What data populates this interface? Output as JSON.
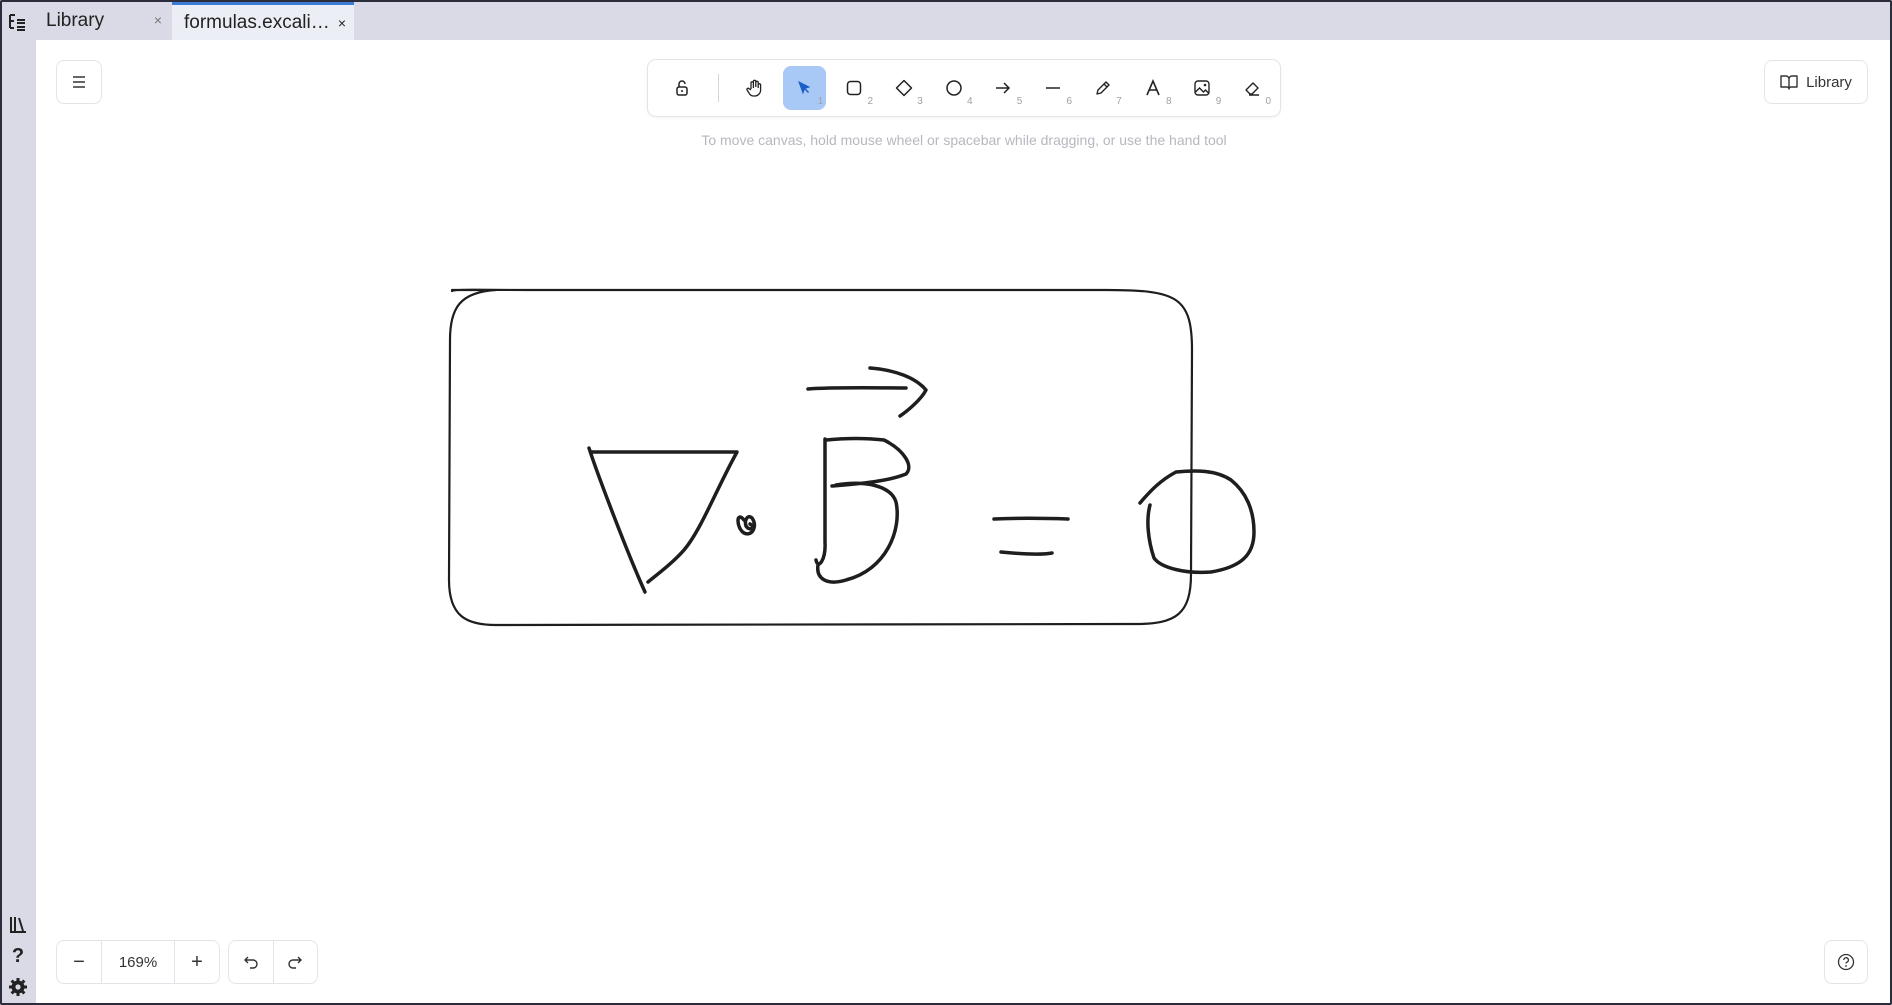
{
  "tabs": [
    {
      "label": "Library",
      "close": "×"
    },
    {
      "label": "formulas.excali…",
      "close": "×"
    }
  ],
  "toolbar": {
    "tools": [
      {
        "name": "hand",
        "key": ""
      },
      {
        "name": "selection",
        "key": "1"
      },
      {
        "name": "rectangle",
        "key": "2"
      },
      {
        "name": "diamond",
        "key": "3"
      },
      {
        "name": "ellipse",
        "key": "4"
      },
      {
        "name": "arrow",
        "key": "5"
      },
      {
        "name": "line",
        "key": "6"
      },
      {
        "name": "draw",
        "key": "7"
      },
      {
        "name": "text",
        "key": "8"
      },
      {
        "name": "image",
        "key": "9"
      },
      {
        "name": "eraser",
        "key": "0"
      }
    ],
    "active_tool": "selection"
  },
  "hint": "To move canvas, hold mouse wheel or spacebar while dragging, or use the hand tool",
  "library_button": {
    "label": "Library"
  },
  "zoom": {
    "minus": "−",
    "value": "169%",
    "plus": "+"
  },
  "colors": {
    "accent": "#3a7bd5",
    "active_tool_bg": "#a8c8f5",
    "stroke": "#1e1e1e"
  }
}
